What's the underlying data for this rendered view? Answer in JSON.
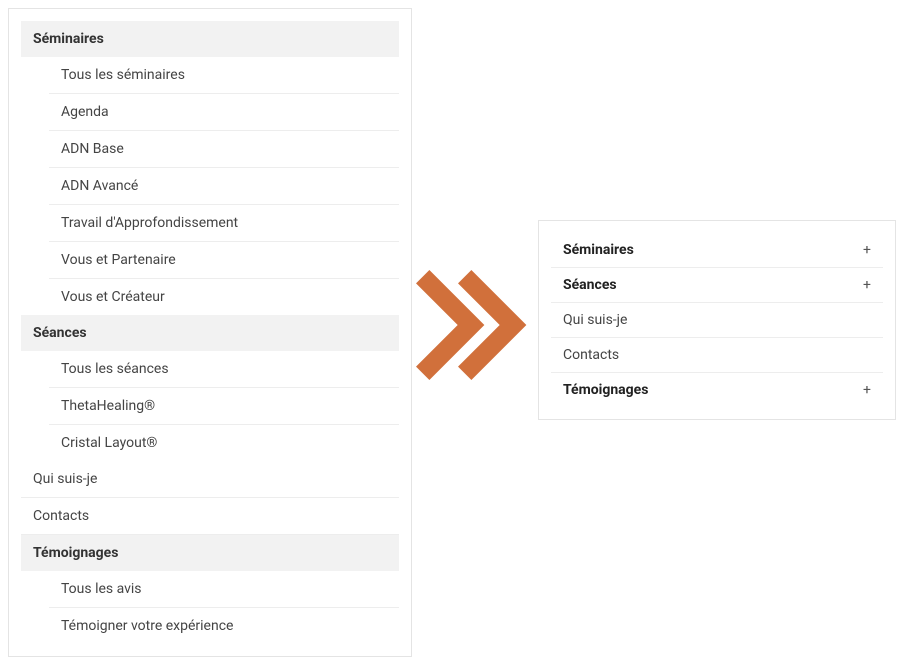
{
  "left_menu": {
    "sections": [
      {
        "header": "Séminaires",
        "items": [
          "Tous les séminaires",
          "Agenda",
          "ADN Base",
          "ADN Avancé",
          "Travail d'Approfondissement",
          "Vous et Partenaire",
          "Vous et Créateur"
        ]
      },
      {
        "header": "Séances",
        "items": [
          "Tous les séances",
          "ThetaHealing®",
          "Cristal Layout®"
        ]
      }
    ],
    "plain": [
      "Qui suis-je",
      "Contacts"
    ],
    "section_last": {
      "header": "Témoignages",
      "items": [
        "Tous les avis",
        "Témoigner votre expérience"
      ]
    }
  },
  "right_menu": {
    "items": [
      {
        "label": "Séminaires",
        "bold": true,
        "expandable": true
      },
      {
        "label": "Séances",
        "bold": true,
        "expandable": true
      },
      {
        "label": "Qui suis-je",
        "bold": false,
        "expandable": false
      },
      {
        "label": "Contacts",
        "bold": false,
        "expandable": false
      },
      {
        "label": "Témoignages",
        "bold": true,
        "expandable": true
      }
    ],
    "expand_symbol": "+"
  },
  "arrow_color": "#d1703b"
}
